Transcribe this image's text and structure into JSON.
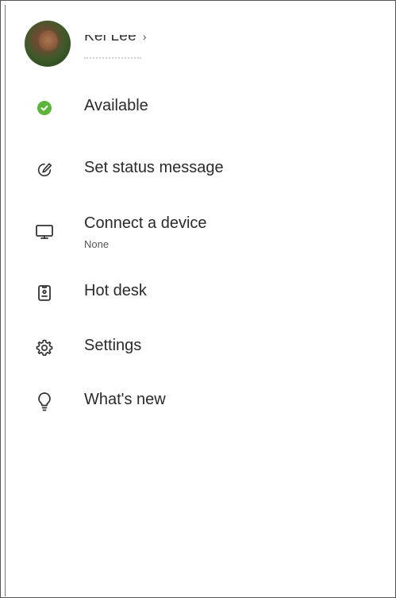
{
  "profile": {
    "name": "Kei Lee",
    "chevron": "›"
  },
  "menu": {
    "status": {
      "label": "Available",
      "color": "#5bb53a",
      "icon": "check-circle-icon"
    },
    "set_status": {
      "label": "Set status message",
      "icon": "pencil-circle-icon"
    },
    "connect_device": {
      "label": "Connect a device",
      "sub": "None",
      "icon": "monitor-icon"
    },
    "hot_desk": {
      "label": "Hot desk",
      "icon": "badge-icon"
    },
    "settings": {
      "label": "Settings",
      "icon": "gear-icon"
    },
    "whats_new": {
      "label": "What's new",
      "icon": "lightbulb-icon"
    }
  }
}
